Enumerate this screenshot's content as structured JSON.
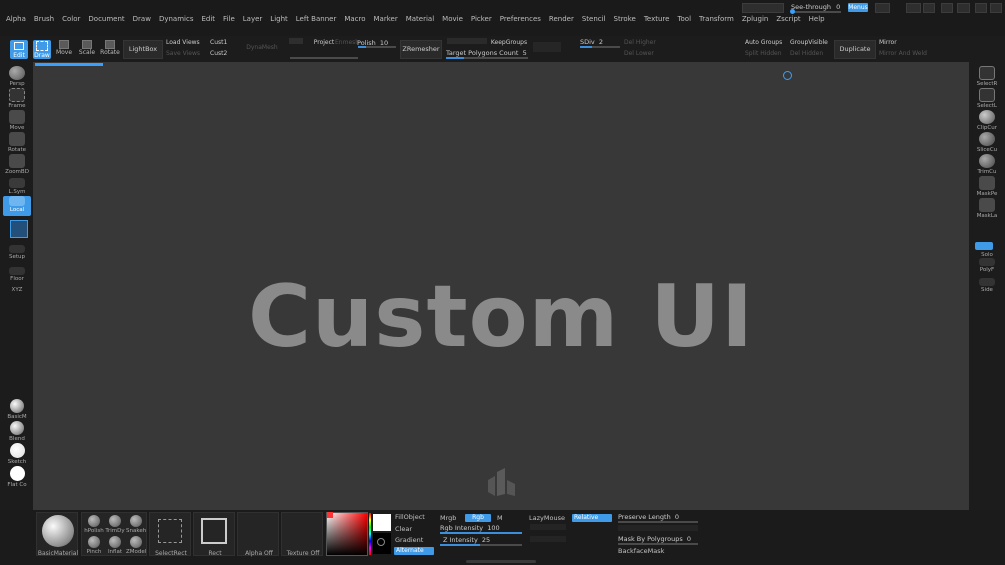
{
  "menubar": {
    "items": [
      "Alpha",
      "Brush",
      "Color",
      "Document",
      "Draw",
      "Dynamics",
      "Edit",
      "File",
      "Layer",
      "Light",
      "Left Banner",
      "Macro",
      "Marker",
      "Material",
      "Movie",
      "Picker",
      "Preferences",
      "Render",
      "Stencil",
      "Stroke",
      "Texture",
      "Tool",
      "Transform",
      "Zplugin",
      "Zscript",
      "Help"
    ],
    "see_through_label": "See-through",
    "see_through_value": "0",
    "menus_label": "Menus"
  },
  "toolbar": {
    "edit": "Edit",
    "draw": "Draw",
    "move": "Move",
    "scale": "Scale",
    "rotate": "Rotate",
    "lightbox": "LightBox",
    "load_views": "Load Views",
    "save_views": "Save Views",
    "cust1": "Cust1",
    "cust2": "Cust2",
    "dynamesh": "DynaMesh",
    "project": "Project",
    "enmesh": "Enmesh",
    "polish_label": "Polish",
    "polish_value": "10",
    "zremesher": "ZRemesher",
    "keepgroups": "KeepGroups",
    "target_polygons_label": "Target Polygons Count",
    "target_polygons_value": "5",
    "sdiv_label": "SDiv",
    "sdiv_value": "2",
    "del_higher": "Del Higher",
    "del_lower": "Del Lower",
    "auto_groups": "Auto Groups",
    "split_hidden": "Split Hidden",
    "group_visible": "GroupVisible",
    "del_hidden": "Del Hidden",
    "duplicate": "Duplicate",
    "mirror": "Mirror",
    "mirror_and_weld": "Mirror And Weld"
  },
  "canvas": {
    "title": "Custom UI"
  },
  "left_shelf": {
    "items": [
      "Persp",
      "Frame",
      "Move",
      "Rotate",
      "ZoomBD",
      "L.Sym",
      "Local",
      "",
      "Setup",
      "Floor",
      "XYZ"
    ],
    "materials": [
      "BasicM",
      "Blend",
      "Sketch",
      "Flat Co"
    ]
  },
  "right_shelf": {
    "items": [
      "SelectR",
      "SelectL",
      "ClipCur",
      "SliceCu",
      "TrimCu",
      "MaskPe",
      "MaskLa",
      "",
      "Solo",
      "PolyF",
      "Side"
    ]
  },
  "bottom": {
    "basic_material": "BasicMaterial",
    "brushes": [
      "hPolish",
      "TrimDy",
      "Snakeh",
      "Pinch",
      "Inflat",
      "ZModel"
    ],
    "select_rect": "SelectRect",
    "rect": "Rect",
    "alpha_off": "Alpha Off",
    "texture_off": "Texture Off",
    "fill_object": "FillObject",
    "clear": "Clear",
    "gradient": "Gradient",
    "alternate": "Alternate",
    "mrgb": "Mrgb",
    "rgb": "Rgb",
    "m": "M",
    "rgb_intensity_label": "Rgb Intensity",
    "rgb_intensity_value": "100",
    "z_intensity_label": "Z Intensity",
    "z_intensity_value": "25",
    "lazymouse": "LazyMouse",
    "relative": "Relative",
    "preserve_length_label": "Preserve Length",
    "preserve_length_value": "0",
    "mask_by_polygroups_label": "Mask By Polygroups",
    "mask_by_polygroups_value": "0",
    "backface_mask": "BackfaceMask"
  },
  "colors": {
    "accent": "#3aa0ff",
    "canvas": "#383838",
    "shelf": "#1c1c1c"
  }
}
